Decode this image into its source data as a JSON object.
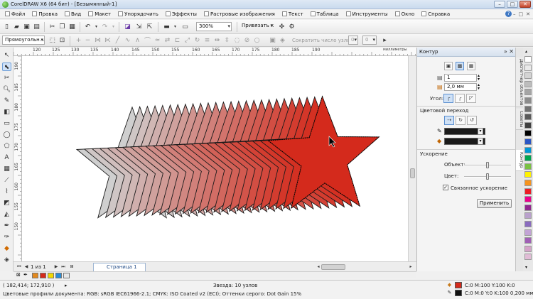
{
  "window": {
    "title": "CorelDRAW X6 (64 бит) - [Безымянный-1]",
    "controls": [
      "–",
      "□",
      "✕"
    ]
  },
  "menu": {
    "items": [
      "Файл",
      "Правка",
      "Вид",
      "Макет",
      "Упорядочить",
      "Эффекты",
      "Растровые изображения",
      "Текст",
      "Таблица",
      "Инструменты",
      "Окно",
      "Справка"
    ],
    "help_glyph": "?",
    "doc_controls": [
      "–",
      "□",
      "✕"
    ]
  },
  "toolbar": {
    "zoom": "300%",
    "snap": "Привязать к"
  },
  "propbar": {
    "object_type": "Прямоугольн...",
    "reduce_nodes": "Сократить число узлов",
    "reduce_nodes_value": "0",
    "value_field": "0"
  },
  "rulers": {
    "h": [
      "120",
      "125",
      "130",
      "135",
      "140",
      "145",
      "150",
      "155",
      "160",
      "165",
      "170",
      "175",
      "180",
      "185",
      "190"
    ],
    "h_unit": "миллиметры",
    "v": [
      "190",
      "185",
      "180",
      "175",
      "170",
      "165",
      "160",
      "155",
      "150"
    ]
  },
  "pages": {
    "counter": "1 из 1",
    "tab_label": "Страница 1"
  },
  "docker": {
    "title": "Контур",
    "steps_value": "1",
    "offset_value": "2,0 мм",
    "angle_label": "Угол:",
    "color_transition_label": "Цветовой переход",
    "acceleration_label": "Ускорение",
    "object_label": "Объект:",
    "object_accel": 0.5,
    "color_label": "Цвет:",
    "color_accel": 0.5,
    "linked_accel_label": "Связанное ускорение",
    "linked_accel_checked": true,
    "apply_label": "Применить"
  },
  "side_tabs": [
    "Диспетчер объектов",
    "Советы",
    "Контур"
  ],
  "palette_colors": [
    "#ffffff",
    "#eaeaea",
    "#d4d4d4",
    "#bdbdbd",
    "#a5a5a5",
    "#8c8c8c",
    "#737373",
    "#5a5a5a",
    "#404040",
    "#000000",
    "#2b56c5",
    "#0097d6",
    "#00a650",
    "#7ac143",
    "#fff200",
    "#f7941d",
    "#ed1c24",
    "#ec008c",
    "#92278f",
    "#b9a0cc",
    "#8a6bbf",
    "#c2a3d5",
    "#a05fb5",
    "#d4a3c9",
    "#e1bcd6"
  ],
  "doc_palette": [
    "#e2891f",
    "#d52a1b",
    "#f0d800",
    "#2a8bd3",
    "#e7e7e7"
  ],
  "status": {
    "coords": "( 182,414; 172,910 )",
    "object_info": "Звезда: 10 узлов",
    "color_profile": "Цветовые профили документа: RGB: sRGB IEC61966-2.1; CMYK: ISO Coated v2 (ECI); Оттенки серого: Dot Gain 15%",
    "fill_info": "C:0 M:100 Y:100 K:0",
    "outline_info": "C:0 M:0 Y:0 K:100  0,200 мм",
    "fill_color": "#d52a1b",
    "outline_color": "#111111"
  },
  "art": {
    "start_color": "#cfcfcf",
    "end_color": "#d42a1c",
    "steps": 26
  }
}
